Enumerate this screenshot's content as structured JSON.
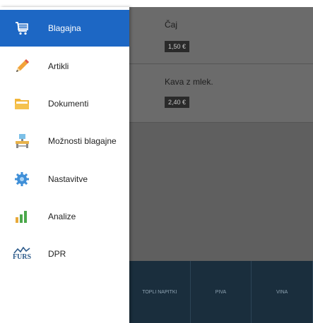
{
  "menu": {
    "items": [
      {
        "label": "Blagajna",
        "icon": "cart-icon",
        "active": true
      },
      {
        "label": "Artikli",
        "icon": "pencil-icon",
        "active": false
      },
      {
        "label": "Dokumenti",
        "icon": "folder-icon",
        "active": false
      },
      {
        "label": "Možnosti blagajne",
        "icon": "cash-register-icon",
        "active": false
      },
      {
        "label": "Nastavitve",
        "icon": "gear-icon",
        "active": false
      },
      {
        "label": "Analize",
        "icon": "bar-chart-icon",
        "active": false
      },
      {
        "label": "DPR",
        "icon": "furs-icon",
        "active": false
      }
    ],
    "furs_text": "FURS"
  },
  "products": [
    {
      "name": "Čaj",
      "price": "1,50 €"
    },
    {
      "name": "Kava z mlek.",
      "price": "2,40 €"
    }
  ],
  "categories": [
    "TOPLI NAPITKI",
    "PIVA",
    "VINA"
  ],
  "colors": {
    "accent": "#1d67c4",
    "overlay": "#5f5f5f",
    "category_bar": "#1a2e3d"
  }
}
